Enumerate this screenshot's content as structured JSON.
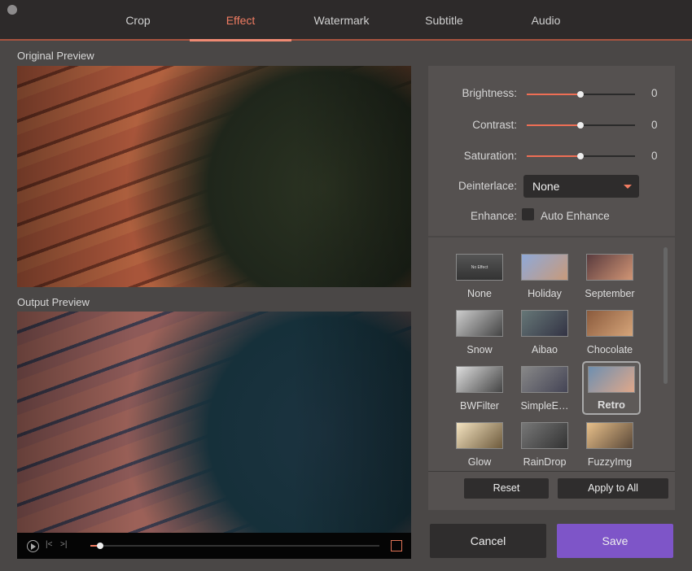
{
  "tabs": [
    "Crop",
    "Effect",
    "Watermark",
    "Subtitle",
    "Audio"
  ],
  "active_tab": "Effect",
  "original_preview_label": "Original Preview",
  "output_preview_label": "Output Preview",
  "player": {
    "progress": 0.03
  },
  "adjust": {
    "brightness": {
      "label": "Brightness:",
      "value": "0"
    },
    "contrast": {
      "label": "Contrast:",
      "value": "0"
    },
    "saturation": {
      "label": "Saturation:",
      "value": "0"
    },
    "deinterlace": {
      "label": "Deinterlace:",
      "value": "None"
    },
    "enhance": {
      "label": "Enhance:",
      "checkbox_label": "Auto Enhance",
      "checked": false
    }
  },
  "effects": [
    {
      "name": "None",
      "thumb_text": "No Effect"
    },
    {
      "name": "Holiday"
    },
    {
      "name": "September"
    },
    {
      "name": "Snow"
    },
    {
      "name": "Aibao"
    },
    {
      "name": "Chocolate"
    },
    {
      "name": "BWFilter"
    },
    {
      "name": "SimpleE…"
    },
    {
      "name": "Retro",
      "selected": true
    },
    {
      "name": "Glow"
    },
    {
      "name": "RainDrop"
    },
    {
      "name": "FuzzyImg"
    }
  ],
  "buttons": {
    "reset": "Reset",
    "apply_all": "Apply to All",
    "cancel": "Cancel",
    "save": "Save"
  },
  "colors": {
    "accent": "#f07c62",
    "save": "#7e55c8"
  }
}
